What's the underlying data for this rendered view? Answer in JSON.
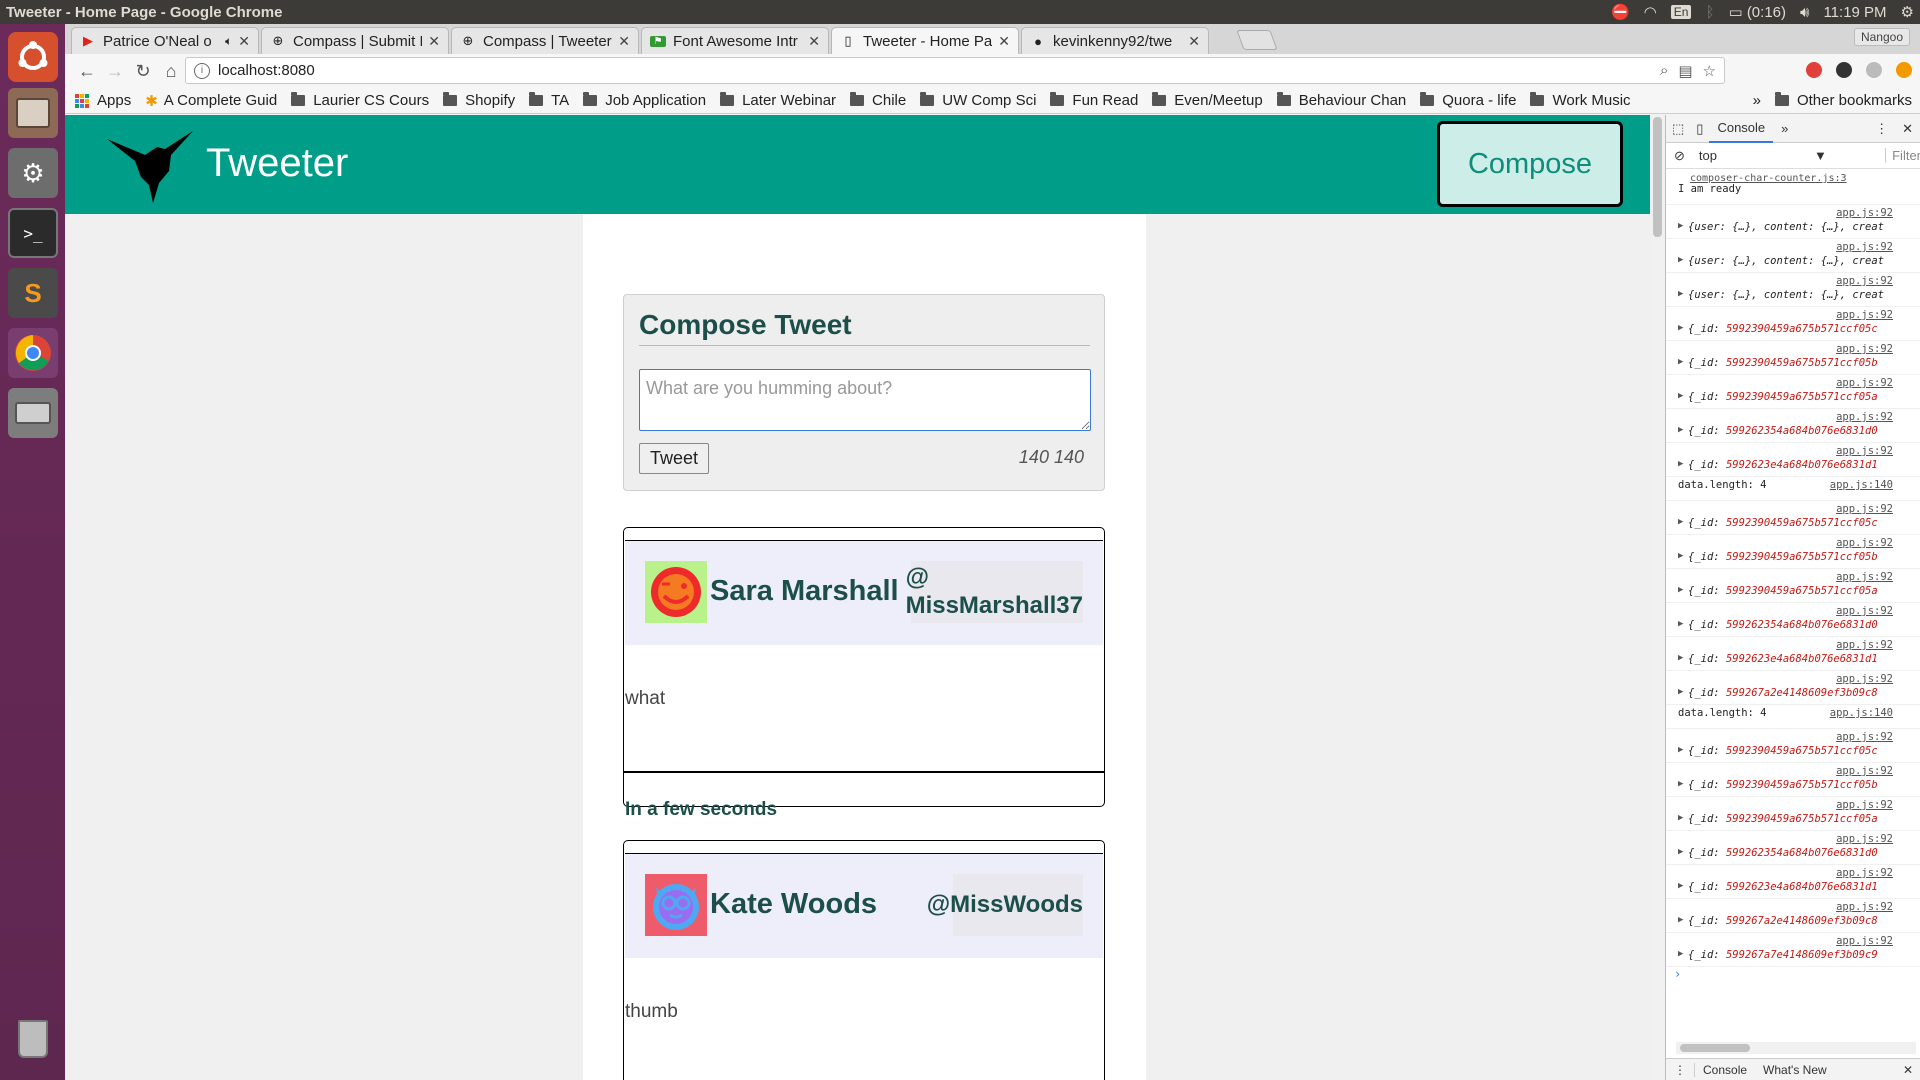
{
  "os": {
    "window_title": "Tweeter - Home Page - Google Chrome",
    "battery": "(0:16)",
    "time": "11:19 PM",
    "lang": "En"
  },
  "browser": {
    "tabs": [
      {
        "label": "Patrice O'Neal o",
        "favicon": "youtube-icon",
        "active": false
      },
      {
        "label": "Compass | Submit P",
        "favicon": "compass-icon",
        "active": false
      },
      {
        "label": "Compass | Tweeter",
        "favicon": "compass-icon",
        "active": false
      },
      {
        "label": "Font Awesome Intr",
        "favicon": "fontawesome-icon",
        "active": false
      },
      {
        "label": "Tweeter - Home Pa",
        "favicon": "page-icon",
        "active": true
      },
      {
        "label": "kevinkenny92/twe",
        "favicon": "github-icon",
        "active": false
      }
    ],
    "profile": "Nangoo",
    "url": "localhost:8080",
    "bookmarks": [
      {
        "label": "Apps",
        "type": "apps"
      },
      {
        "label": "A Complete Guid",
        "type": "star"
      },
      {
        "label": "Laurier CS Cours",
        "type": "folder"
      },
      {
        "label": "Shopify",
        "type": "folder"
      },
      {
        "label": "TA",
        "type": "folder"
      },
      {
        "label": "Job Application",
        "type": "folder"
      },
      {
        "label": "Later Webinar",
        "type": "folder"
      },
      {
        "label": "Chile",
        "type": "folder"
      },
      {
        "label": "UW Comp Sci",
        "type": "folder"
      },
      {
        "label": "Fun Read",
        "type": "folder"
      },
      {
        "label": "Even/Meetup",
        "type": "folder"
      },
      {
        "label": "Behaviour Chan",
        "type": "folder"
      },
      {
        "label": "Quora - life",
        "type": "folder"
      },
      {
        "label": "Work Music",
        "type": "folder"
      }
    ],
    "other_bookmarks": "Other bookmarks",
    "more": "»"
  },
  "site": {
    "brand": "Tweeter",
    "compose_label": "Compose",
    "header_color": "#009e88",
    "compose": {
      "title": "Compose Tweet",
      "placeholder": "What are you humming about?",
      "button": "Tweet",
      "counter": "140 140"
    },
    "tweets": [
      {
        "name": "Sara Marshall",
        "handle": "@ MissMarshall37",
        "body": "what",
        "time": "In a few seconds",
        "avatar_bg": "#b9f28a",
        "avatar_face": "#ee2a2a"
      },
      {
        "name": "Kate Woods",
        "handle": "@MissWoods",
        "body": "thumb",
        "time": "",
        "avatar_bg": "#ee5b6a",
        "avatar_face": "#4fa9f2"
      }
    ]
  },
  "devtools": {
    "tabs": [
      "Console",
      "»"
    ],
    "context": "top",
    "filter": "Filter",
    "logs": [
      {
        "src": "composer-char-counter.js:3",
        "msg": "I am ready",
        "type": "text"
      },
      {
        "src": "app.js:92",
        "msg": "{user: {…}, content: {…}, creat",
        "type": "obj"
      },
      {
        "src": "app.js:92",
        "msg": "{user: {…}, content: {…}, creat",
        "type": "obj"
      },
      {
        "src": "app.js:92",
        "msg": "{user: {…}, content: {…}, creat",
        "type": "obj"
      },
      {
        "src": "app.js:92",
        "msg": "5992390459a675b571ccf05c",
        "type": "id"
      },
      {
        "src": "app.js:92",
        "msg": "5992390459a675b571ccf05b",
        "type": "id"
      },
      {
        "src": "app.js:92",
        "msg": "5992390459a675b571ccf05a",
        "type": "id"
      },
      {
        "src": "app.js:92",
        "msg": "599262354a684b076e6831d0",
        "type": "id"
      },
      {
        "src": "app.js:92",
        "msg": "5992623e4a684b076e6831d1",
        "type": "id"
      },
      {
        "src": "app.js:140",
        "msg": "data.length: 4",
        "type": "len"
      },
      {
        "src": "app.js:92",
        "msg": "5992390459a675b571ccf05c",
        "type": "id"
      },
      {
        "src": "app.js:92",
        "msg": "5992390459a675b571ccf05b",
        "type": "id"
      },
      {
        "src": "app.js:92",
        "msg": "5992390459a675b571ccf05a",
        "type": "id"
      },
      {
        "src": "app.js:92",
        "msg": "599262354a684b076e6831d0",
        "type": "id"
      },
      {
        "src": "app.js:92",
        "msg": "5992623e4a684b076e6831d1",
        "type": "id"
      },
      {
        "src": "app.js:92",
        "msg": "599267a2e4148609ef3b09c8",
        "type": "id"
      },
      {
        "src": "app.js:140",
        "msg": "data.length: 4",
        "type": "len"
      },
      {
        "src": "app.js:92",
        "msg": "5992390459a675b571ccf05c",
        "type": "id"
      },
      {
        "src": "app.js:92",
        "msg": "5992390459a675b571ccf05b",
        "type": "id"
      },
      {
        "src": "app.js:92",
        "msg": "5992390459a675b571ccf05a",
        "type": "id"
      },
      {
        "src": "app.js:92",
        "msg": "599262354a684b076e6831d0",
        "type": "id"
      },
      {
        "src": "app.js:92",
        "msg": "5992623e4a684b076e6831d1",
        "type": "id"
      },
      {
        "src": "app.js:92",
        "msg": "599267a2e4148609ef3b09c8",
        "type": "id"
      },
      {
        "src": "app.js:92",
        "msg": "599267a7e4148609ef3b09c9",
        "type": "id"
      }
    ],
    "bottom_tabs": [
      "Console",
      "What's New"
    ]
  }
}
